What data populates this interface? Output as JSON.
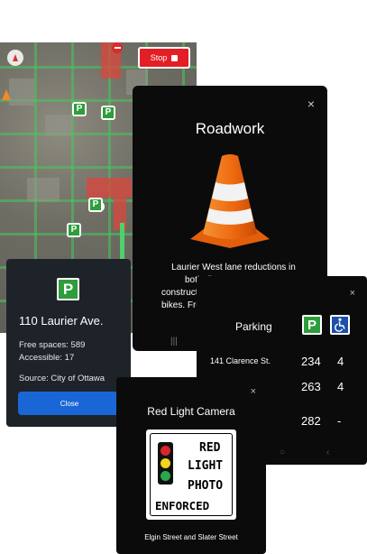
{
  "map": {
    "stop_button": {
      "label": "Stop"
    }
  },
  "roadwork_popup": {
    "title": "Roadwork",
    "close": "×",
    "description_lines": [
      "Laurier West lane reductions in",
      "both di",
      "constructio",
      "bikes. From"
    ]
  },
  "parking_popup": {
    "badge": "P",
    "name": "110 Laurier Ave.",
    "free_spaces": "Free spaces: 589",
    "accessible": "Accessible: 17",
    "source": "Source: City of Ottawa",
    "close_label": "Close"
  },
  "parking_list": {
    "close": "×",
    "header": "Parking",
    "badge": "P",
    "rows": [
      {
        "lot": "141 Clarence St.",
        "free": "234",
        "accessible": "4"
      },
      {
        "lot": "",
        "free": "263",
        "accessible": "4"
      },
      {
        "lot": "",
        "free": "282",
        "accessible": "-"
      }
    ]
  },
  "camera_popup": {
    "close": "×",
    "title": "Red Light Camera",
    "sign_lines": [
      "RED",
      "LIGHT",
      "PHOTO",
      "ENFORCED"
    ],
    "location": "Elgin Street and Slater Street",
    "colors": {
      "red": "#d8262b",
      "yellow": "#f3d41a",
      "green": "#29a84a"
    }
  }
}
